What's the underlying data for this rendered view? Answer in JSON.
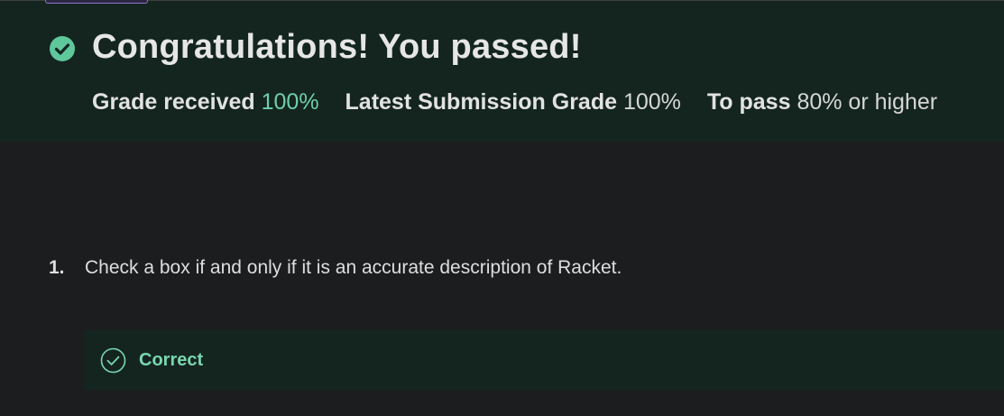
{
  "banner": {
    "title": "Congratulations! You passed!",
    "check_icon": "check-circle-filled-icon",
    "grade_received_label": "Grade received",
    "grade_received_value": "100%",
    "latest_label": "Latest Submission Grade",
    "latest_value": "100%",
    "to_pass_label": "To pass",
    "to_pass_value": "80% or higher",
    "accent_color": "#6fcfa9"
  },
  "questions": [
    {
      "number": "1.",
      "text": "Check a box if and only if it is an accurate description of Racket.",
      "feedback": {
        "label": "Correct",
        "icon": "check-circle-outline-icon"
      }
    }
  ]
}
